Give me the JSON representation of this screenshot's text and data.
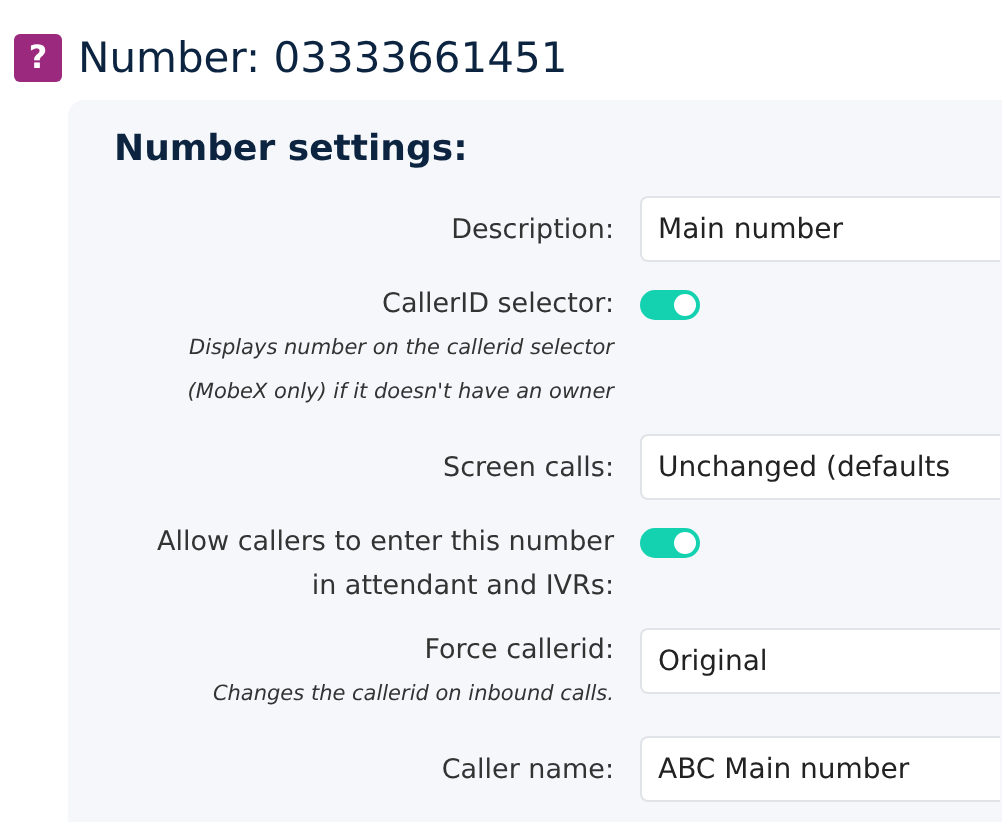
{
  "page": {
    "icon": "?",
    "title": "Number: 03333661451"
  },
  "panel": {
    "heading": "Number settings:",
    "rows": [
      {
        "kind": "field",
        "label": "Description:",
        "value": "Main number"
      },
      {
        "kind": "toggle",
        "label": "CallerID selector:",
        "hint": "Displays number on the callerid selector (MobeX only) if it doesn't have an owner",
        "on": true
      },
      {
        "kind": "field",
        "label": "Screen calls:",
        "value": "Unchanged (defaults"
      },
      {
        "kind": "toggle",
        "label": "Allow callers to enter this number in attendant and IVRs:",
        "on": true
      },
      {
        "kind": "field",
        "label": "Force callerid:",
        "hint": "Changes the callerid on inbound calls.",
        "value": "Original"
      },
      {
        "kind": "field",
        "label": "Caller name:",
        "value": "ABC Main number"
      }
    ]
  }
}
